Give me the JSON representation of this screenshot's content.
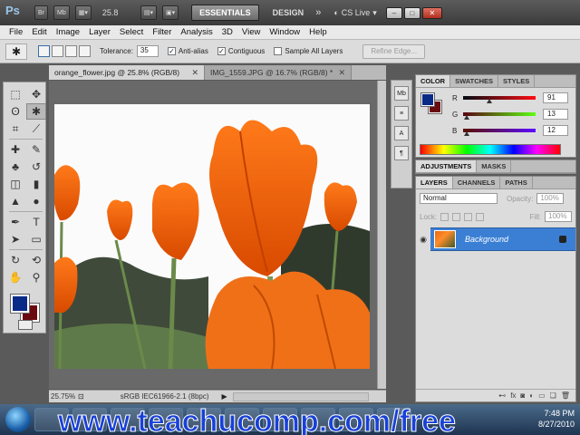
{
  "app": {
    "logo": "Ps",
    "bar_buttons": [
      "Br",
      "Mb"
    ],
    "zoom": "25.8",
    "workspaces": {
      "active": "ESSENTIALS",
      "other": "DESIGN",
      "more": "»"
    },
    "cs_live": "CS Live",
    "window_controls": [
      "–",
      "□",
      "✕"
    ]
  },
  "menu": [
    "File",
    "Edit",
    "Image",
    "Layer",
    "Select",
    "Filter",
    "Analysis",
    "3D",
    "View",
    "Window",
    "Help"
  ],
  "options_bar": {
    "tolerance_label": "Tolerance:",
    "tolerance_value": "35",
    "anti_alias": {
      "label": "Anti-alias",
      "checked": true
    },
    "contiguous": {
      "label": "Contiguous",
      "checked": true
    },
    "sample_all": {
      "label": "Sample All Layers",
      "checked": false
    },
    "refine_edge": "Refine Edge..."
  },
  "documents": [
    {
      "title": "orange_flower.jpg @ 25.8% (RGB/8)",
      "active": true
    },
    {
      "title": "IMG_1559.JPG @ 16.7% (RGB/8) *",
      "active": false
    }
  ],
  "status": {
    "zoom": "25.75%",
    "profile": "sRGB IEC61966-2.1 (8bpc)"
  },
  "color_panel": {
    "tabs": [
      "COLOR",
      "SWATCHES",
      "STYLES"
    ],
    "channels": [
      {
        "name": "R",
        "value": "91",
        "fraction": 0.36,
        "gradient": "linear-gradient(90deg,#000c12,#ff0c12)"
      },
      {
        "name": "G",
        "value": "13",
        "fraction": 0.05,
        "gradient": "linear-gradient(90deg,#5b0012,#5bff12)"
      },
      {
        "name": "B",
        "value": "12",
        "fraction": 0.05,
        "gradient": "linear-gradient(90deg,#5b0d00,#5b0dff)"
      }
    ]
  },
  "adjustments": {
    "tabs": [
      "ADJUSTMENTS",
      "MASKS"
    ]
  },
  "layers_panel": {
    "tabs": [
      "LAYERS",
      "CHANNELS",
      "PATHS"
    ],
    "blend_mode": "Normal",
    "opacity_label": "Opacity:",
    "opacity": "100%",
    "lock_label": "Lock:",
    "fill_label": "Fill:",
    "fill": "100%",
    "layer_name": "Background"
  },
  "taskbar": {
    "watermark": "www.teachucomp.com/free",
    "time": "7:48 PM",
    "date": "8/27/2010"
  }
}
